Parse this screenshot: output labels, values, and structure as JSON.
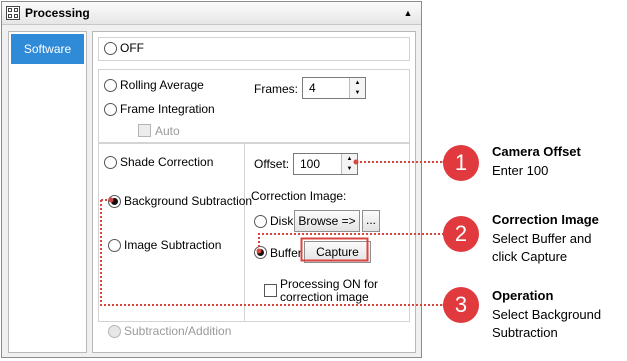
{
  "panel": {
    "title": "Processing",
    "icon": "panel-grid-icon",
    "collapse_icon": "▲",
    "sidebar": {
      "items": [
        {
          "label": "Software",
          "selected": true
        }
      ]
    }
  },
  "options": {
    "off": "OFF",
    "rolling_average": "Rolling Average",
    "frame_integration": "Frame Integration",
    "auto": "Auto",
    "frames_label": "Frames:",
    "frames_value": "4",
    "shade_correction": "Shade Correction",
    "background_subtraction": "Background Subtraction",
    "image_subtraction": "Image Subtraction",
    "offset_label": "Offset:",
    "offset_value": "100",
    "correction_image_label": "Correction Image:",
    "disk": "Disk",
    "browse": "Browse =>",
    "ellipsis": "...",
    "buffer": "Buffer",
    "capture": "Capture",
    "processing_on_line1": "Processing ON for",
    "processing_on_line2": "correction image",
    "subtraction_addition": "Subtraction/Addition"
  },
  "callouts": [
    {
      "number": "1",
      "title": "Camera Offset",
      "lines": [
        "Enter 100"
      ]
    },
    {
      "number": "2",
      "title": "Correction Image",
      "lines": [
        "Select Buffer and",
        "click Capture"
      ]
    },
    {
      "number": "3",
      "title": "Operation",
      "lines": [
        "Select Background",
        "Subtraction"
      ]
    }
  ],
  "colors": {
    "accent": "#2f8ad8",
    "callout": "#e03a3e",
    "highlight_border": "#d9453f"
  }
}
